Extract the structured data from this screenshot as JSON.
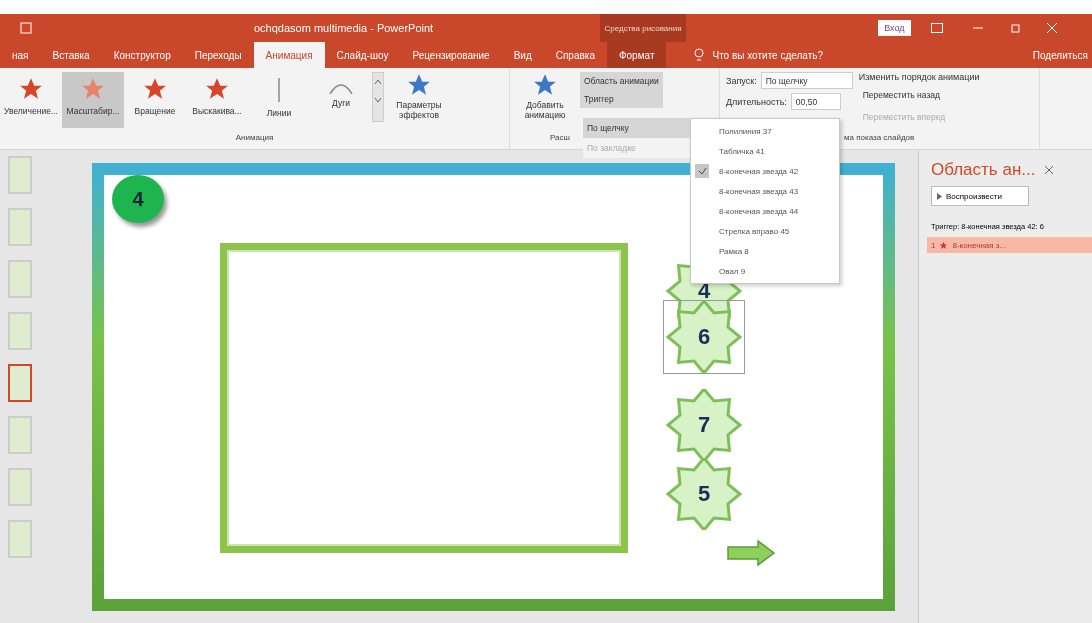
{
  "window": {
    "title": "ochqdasom multimedia - PowerPoint",
    "context_group": "Средства рисования",
    "sign_in": "Вход",
    "share": "Поделиться"
  },
  "tabs": [
    {
      "label": "ная",
      "selected": false,
      "kind": "normal"
    },
    {
      "label": "Вставка",
      "selected": false,
      "kind": "normal"
    },
    {
      "label": "Конструктор",
      "selected": false,
      "kind": "normal"
    },
    {
      "label": "Переходы",
      "selected": false,
      "kind": "normal"
    },
    {
      "label": "Анимация",
      "selected": true,
      "kind": "normal"
    },
    {
      "label": "Слайд-шоу",
      "selected": false,
      "kind": "normal"
    },
    {
      "label": "Рецензирование",
      "selected": false,
      "kind": "normal"
    },
    {
      "label": "Вид",
      "selected": false,
      "kind": "normal"
    },
    {
      "label": "Справка",
      "selected": false,
      "kind": "normal"
    },
    {
      "label": "Формат",
      "selected": false,
      "kind": "contextual"
    }
  ],
  "tell_me": {
    "placeholder": "Что вы хотите сделать?"
  },
  "ribbon": {
    "gallery": [
      {
        "label": "Увеличение...",
        "selected": false,
        "kind": "sparkle"
      },
      {
        "label": "Масштабир...",
        "selected": true,
        "kind": "burst"
      },
      {
        "label": "Вращение",
        "selected": false,
        "kind": "spin"
      },
      {
        "label": "Выскакива...",
        "selected": false,
        "kind": "pop"
      },
      {
        "label": "Линии",
        "selected": false,
        "kind": "line"
      },
      {
        "label": "Дуги",
        "selected": false,
        "kind": "arc"
      }
    ],
    "effect_options": "Параметры эффектов",
    "group_label": "Анимация",
    "add_animation": "Добавить анимацию",
    "animation_pane": "Область анимации",
    "trigger": "Триггер",
    "advanced_label": "Расш",
    "trigger_menu": [
      {
        "label": "По щелчку",
        "disabled": false,
        "selected": true
      },
      {
        "label": "По закладке",
        "disabled": true,
        "selected": false
      }
    ],
    "start_label": "Запуск:",
    "start_value": "По щелчку",
    "duration_label": "Длительность:",
    "duration_value": "00,50",
    "reorder_label": "Изменить порядок анимации",
    "move_earlier": {
      "label": "Переместить назад",
      "disabled": false
    },
    "move_later": {
      "label": "Переместить вперед",
      "disabled": true
    },
    "timing_label": "ма показа слайдов"
  },
  "objects_menu": [
    {
      "label": "Полилиния 37",
      "checked": false
    },
    {
      "label": "Табличка 41",
      "checked": false
    },
    {
      "label": "8-конечная звезда 42",
      "checked": true
    },
    {
      "label": "8-конечная звезда 43",
      "checked": false
    },
    {
      "label": "8-конечная звезда 44",
      "checked": false
    },
    {
      "label": "Стрелка вправо 45",
      "checked": false
    },
    {
      "label": "Рамка 8",
      "checked": false
    },
    {
      "label": "Овал 9",
      "checked": false
    }
  ],
  "thumbnails": [
    {
      "selected": false
    },
    {
      "selected": false
    },
    {
      "selected": false
    },
    {
      "selected": false
    },
    {
      "selected": true
    },
    {
      "selected": false
    },
    {
      "selected": false
    },
    {
      "selected": false
    }
  ],
  "slide": {
    "badge": "4",
    "stars": [
      {
        "label": "4",
        "selected": false
      },
      {
        "label": "6",
        "selected": true
      },
      {
        "label": "7",
        "selected": false
      },
      {
        "label": "5",
        "selected": false
      }
    ]
  },
  "pane": {
    "title": "Область ан...",
    "play": "Воспроизвести",
    "trigger_header": "Триггер: 8-конечная звезда 42: 6",
    "items": [
      {
        "number": "1",
        "label": "8-конечная з...",
        "selected": true
      }
    ]
  }
}
